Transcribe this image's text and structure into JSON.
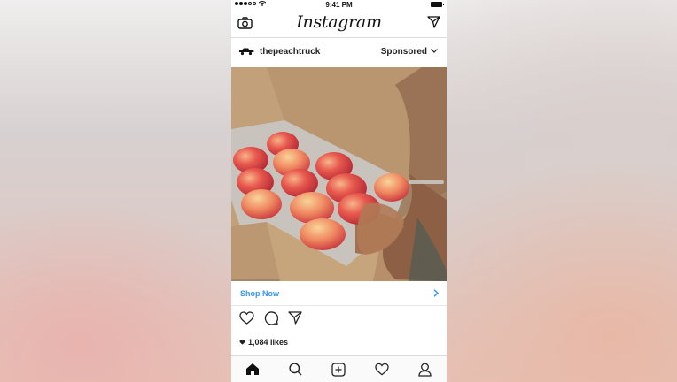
{
  "status_bar": {
    "time": "9:41 PM"
  },
  "header": {
    "app_title": "Instagram",
    "left_icon": "camera-icon",
    "right_icon": "direct-message-icon"
  },
  "post": {
    "username": "thepeachtruck",
    "sponsored_label": "Sponsored",
    "image_description_icon": "peach-box-photo",
    "cta_label": "Shop Now",
    "likes_text": "1,084 likes"
  },
  "tab_bar": {
    "items": [
      "home-icon",
      "search-icon",
      "new-post-icon",
      "activity-icon",
      "profile-icon"
    ]
  },
  "colors": {
    "accent": "#3897f0",
    "text": "#222222"
  }
}
